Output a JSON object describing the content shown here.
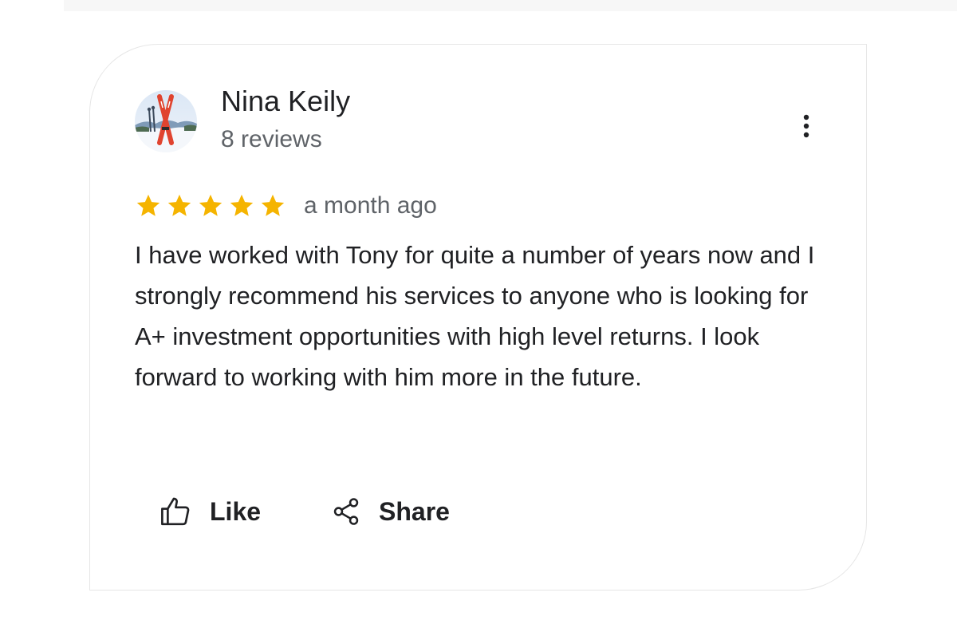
{
  "review": {
    "reviewer": {
      "name": "Nina Keily",
      "meta": "8 reviews",
      "avatar_icon": "skier-avatar"
    },
    "rating": 5,
    "rating_max": 5,
    "time": "a month ago",
    "text": "I have worked with Tony for quite a number of years now and I strongly recommend his services to anyone who is looking for A+ investment opportunities with high level returns. I look forward to working with him more in the future.",
    "actions": {
      "like_label": "Like",
      "like_icon": "thumbs-up-icon",
      "share_label": "Share",
      "share_icon": "share-icon",
      "more_icon": "more-vert-icon"
    },
    "colors": {
      "star": "#F5B400",
      "text": "#202124",
      "secondary_text": "#5F6368"
    }
  }
}
